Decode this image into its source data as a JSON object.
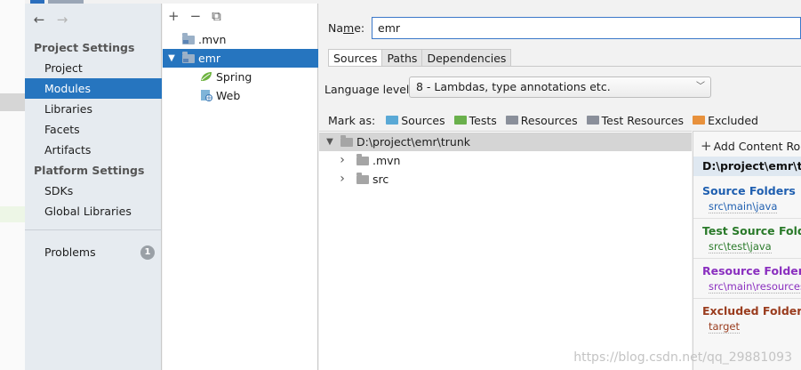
{
  "sidebar": {
    "project_settings_title": "Project Settings",
    "platform_settings_title": "Platform Settings",
    "items": [
      {
        "label": "Project"
      },
      {
        "label": "Modules"
      },
      {
        "label": "Libraries"
      },
      {
        "label": "Facets"
      },
      {
        "label": "Artifacts"
      },
      {
        "label": "SDKs"
      },
      {
        "label": "Global Libraries"
      },
      {
        "label": "Problems",
        "badge": "1"
      }
    ],
    "selected": "Modules"
  },
  "module_tree": {
    "toolbar": {
      "add": "+",
      "remove": "−",
      "copy": "⧉"
    },
    "items": [
      {
        "label": ".mvn"
      },
      {
        "label": "emr",
        "expanded": "▼"
      },
      {
        "label": "Spring"
      },
      {
        "label": "Web"
      }
    ]
  },
  "content": {
    "name_label_prefix": "Na",
    "name_label_underlined": "m",
    "name_label_suffix": "e:",
    "name_value": "emr",
    "tabs": [
      "Sources",
      "Paths",
      "Dependencies"
    ],
    "active_tab": "Sources",
    "language_level_label": "Language level:",
    "language_level_value": "8 - Lambdas, type annotations etc.",
    "mark_as_label": "Mark as:",
    "mark_as": [
      {
        "label": "Sources",
        "color": "#5aa9d6"
      },
      {
        "label": "Tests",
        "color": "#6ab04c"
      },
      {
        "label": "Resources",
        "color": "#8a8f9a"
      },
      {
        "label": "Test Resources",
        "color": "#8a8f9a"
      },
      {
        "label": "Excluded",
        "color": "#e8913c"
      }
    ]
  },
  "source_tree": {
    "root": {
      "label": "D:\\project\\emr\\trunk",
      "expander": "▼"
    },
    "children": [
      {
        "label": ".mvn",
        "expander": "›"
      },
      {
        "label": "src",
        "expander": "›"
      }
    ]
  },
  "content_roots": {
    "add_label": "Add Content Root",
    "path": "D:\\project\\emr\\trunk",
    "sections": [
      {
        "title": "Source Folders",
        "value": "src\\main\\java",
        "color": "#1f5fb0"
      },
      {
        "title": "Test Source Folders",
        "value": "src\\test\\java",
        "color": "#2a7a2a"
      },
      {
        "title": "Resource Folders",
        "value": "src\\main\\resources",
        "color": "#8a2fbf"
      },
      {
        "title": "Excluded Folders",
        "value": "target",
        "color": "#9a3c1e"
      }
    ]
  },
  "watermark": "https://blog.csdn.net/qq_29881093"
}
